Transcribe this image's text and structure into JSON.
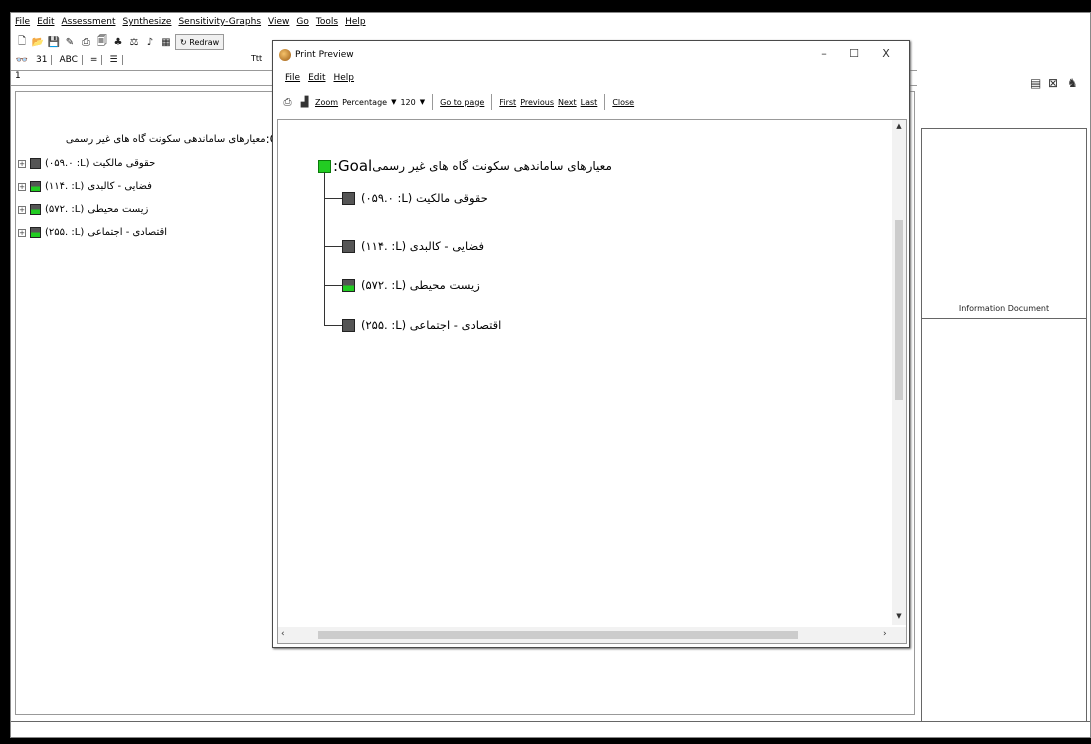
{
  "main_menu": [
    "File",
    "Edit",
    "Assessment",
    "Synthesize",
    "Sensitivity-Graphs",
    "View",
    "Go",
    "Tools",
    "Help"
  ],
  "toolbar": {
    "redraw_label": "Redraw",
    "truncated_label": "Ttt",
    "row2": [
      "31",
      "ABC",
      "="
    ]
  },
  "row_number": "1",
  "goal": {
    "rtl_text": "معیارهای ساماندهی سکونت گاه های غیر رسمی",
    "label": ":Goal",
    "status_color": "#22cc22"
  },
  "left_tree": [
    {
      "text": "(۰۵۹.۰ :L) حقوقی مالکیت",
      "status": "gray"
    },
    {
      "text": "(۱۱۴. :L) فضایی - کالبدی",
      "status": "gray-green"
    },
    {
      "text": "(۵۷۲. :L) زیست محیطی",
      "status": "gray-green"
    },
    {
      "text": "(۲۵۵. :L) اقتصادی - اجتماعی",
      "status": "gray-green"
    }
  ],
  "info_panel": {
    "label": "Information Document"
  },
  "dialog": {
    "title": "Print Preview",
    "menu": [
      "File",
      "Edit",
      "Help"
    ],
    "toolbar": {
      "zoom_label": "Zoom",
      "zoom_mode": "Percentage",
      "zoom_value": "120",
      "buttons": [
        "Go to page",
        "First",
        "Previous",
        "Next",
        "Last",
        "Close"
      ]
    },
    "controls": {
      "minimize": "–",
      "maximize": "☐",
      "close": "X"
    },
    "tree": [
      {
        "text": "(۰۵۹.۰ :L) حقوقی مالکیت",
        "status": "gray"
      },
      {
        "text": "(۱۱۴. :L) فضایی - کالبدی",
        "status": "gray"
      },
      {
        "text": "(۵۷۲. :L) زیست محیطی",
        "status": "gray-green"
      },
      {
        "text": "(۲۵۵. :L) اقتصادی - اجتماعی",
        "status": "gray"
      }
    ]
  }
}
